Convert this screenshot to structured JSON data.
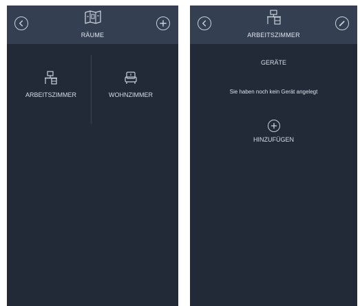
{
  "left_screen": {
    "header": {
      "title": "RÄUME",
      "back_icon": "chevron-left-icon",
      "add_icon": "plus-icon",
      "title_icon": "floorplan-icon"
    },
    "rooms": [
      {
        "label": "ARBEITSZIMMER",
        "icon": "desk-icon"
      },
      {
        "label": "WOHNZIMMER",
        "icon": "armchair-icon"
      }
    ]
  },
  "right_screen": {
    "header": {
      "title": "ARBEITSZIMMER",
      "back_icon": "chevron-left-icon",
      "edit_icon": "pencil-icon",
      "title_icon": "desk-icon"
    },
    "section_title": "GERÄTE",
    "empty_message": "Sie haben noch kein Gerät angelegt",
    "add_label": "HINZUFÜGEN",
    "add_icon": "plus-icon"
  },
  "colors": {
    "background": "#222a38",
    "header": "#344052",
    "text": "#d8dee8"
  }
}
